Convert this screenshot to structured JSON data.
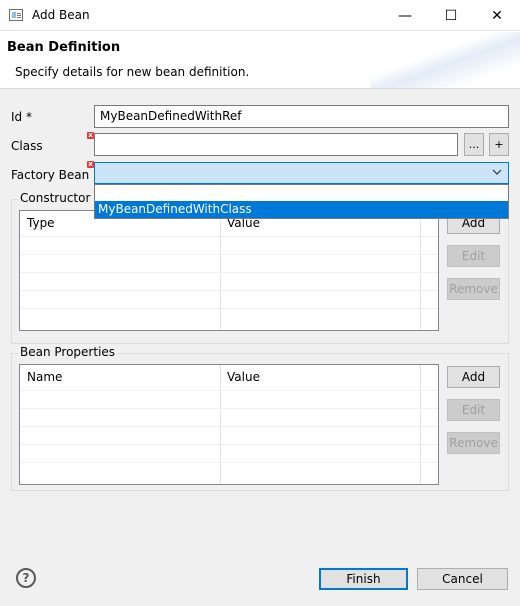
{
  "window": {
    "title": "Add Bean",
    "minimize_glyph": "—",
    "maximize_glyph": "☐",
    "close_glyph": "✕"
  },
  "header": {
    "title": "Bean Definition",
    "description": "Specify details for new bean definition."
  },
  "form": {
    "id_label": "Id *",
    "id_value": "MyBeanDefinedWithRef",
    "class_label": "Class",
    "class_value": "",
    "browse_label": "...",
    "add_label": "+",
    "factory_label": "Factory Bean",
    "factory_value": "",
    "factory_options": [
      "MyBeanDefinedWithClass"
    ]
  },
  "constructor_args": {
    "label": "Constructor A",
    "columns": [
      "Type",
      "Value"
    ],
    "add_label": "Add",
    "edit_label": "Edit",
    "remove_label": "Remove"
  },
  "bean_properties": {
    "label": "Bean Properties",
    "columns": [
      "Name",
      "Value"
    ],
    "add_label": "Add",
    "edit_label": "Edit",
    "remove_label": "Remove"
  },
  "footer": {
    "help_glyph": "?",
    "finish_label": "Finish",
    "cancel_label": "Cancel"
  },
  "icons": {
    "error": "error-icon",
    "dropdown": "chevron-down-icon",
    "help": "help-icon"
  },
  "colors": {
    "accent": "#0078d7",
    "combo_bg": "#cce4f7",
    "error": "#e23b3b"
  }
}
